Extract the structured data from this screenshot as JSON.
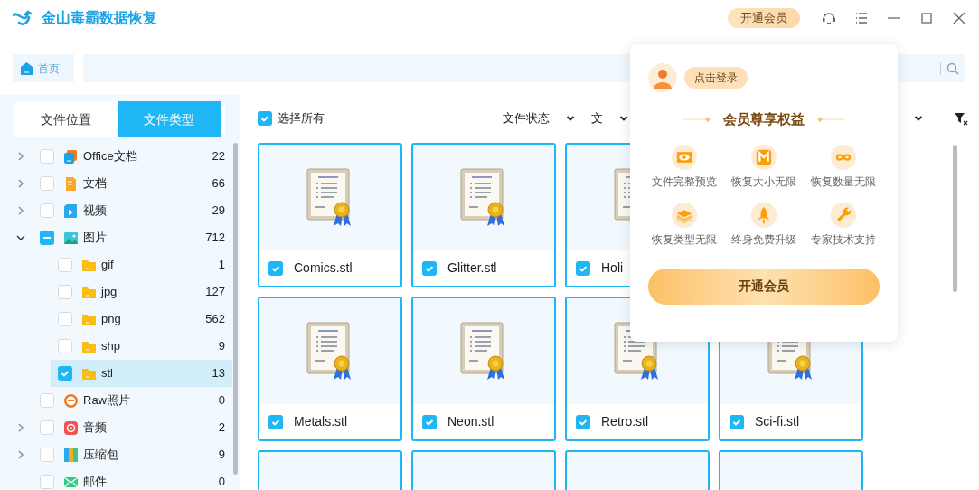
{
  "window": {
    "title": "金山毒霸数据恢复",
    "vip_button": "开通会员"
  },
  "nav": {
    "home_tab": "首页"
  },
  "sidebar": {
    "tabs": [
      {
        "label": "文件位置",
        "selected": false
      },
      {
        "label": "文件类型",
        "selected": true
      }
    ],
    "items": [
      {
        "kind": "office",
        "label": "Office文档",
        "count": "22",
        "checked": false,
        "partial": false,
        "expanded": false,
        "selected": false
      },
      {
        "kind": "doc",
        "label": "文档",
        "count": "66",
        "checked": false,
        "partial": false,
        "expanded": false,
        "selected": false
      },
      {
        "kind": "video",
        "label": "视频",
        "count": "29",
        "checked": false,
        "partial": false,
        "expanded": false,
        "selected": false
      },
      {
        "kind": "image",
        "label": "图片",
        "count": "712",
        "checked": false,
        "partial": true,
        "expanded": true,
        "selected": false,
        "children": [
          {
            "kind": "folder",
            "label": "gif",
            "count": "1",
            "checked": false,
            "partial": false,
            "selected": false
          },
          {
            "kind": "folder",
            "label": "jpg",
            "count": "127",
            "checked": false,
            "partial": false,
            "selected": false
          },
          {
            "kind": "folder",
            "label": "png",
            "count": "562",
            "checked": false,
            "partial": false,
            "selected": false
          },
          {
            "kind": "folder",
            "label": "shp",
            "count": "9",
            "checked": false,
            "partial": false,
            "selected": false
          },
          {
            "kind": "folder",
            "label": "stl",
            "count": "13",
            "checked": true,
            "partial": false,
            "selected": true
          }
        ]
      },
      {
        "kind": "raw",
        "label": "Raw照片",
        "count": "0",
        "checked": false,
        "partial": false,
        "selected": false
      },
      {
        "kind": "audio",
        "label": "音频",
        "count": "2",
        "checked": false,
        "partial": false,
        "expanded": false,
        "selected": false
      },
      {
        "kind": "archive",
        "label": "压缩包",
        "count": "9",
        "checked": false,
        "partial": false,
        "expanded": false,
        "selected": false
      },
      {
        "kind": "mail",
        "label": "邮件",
        "count": "0",
        "checked": false,
        "partial": false,
        "selected": false
      }
    ]
  },
  "toolbar": {
    "select_all": {
      "label": "选择所有",
      "checked": true
    },
    "filters": [
      {
        "label": "文件状态"
      },
      {
        "label": "文"
      }
    ]
  },
  "cards": [
    {
      "kind": "file",
      "name": "Comics.stl",
      "checked": true
    },
    {
      "kind": "file",
      "name": "Glitter.stl",
      "checked": true
    },
    {
      "kind": "file",
      "name": "Holi",
      "checked": true
    },
    {
      "kind": "hidden"
    },
    {
      "kind": "file",
      "name": "Metals.stl",
      "checked": true
    },
    {
      "kind": "file",
      "name": "Neon.stl",
      "checked": true
    },
    {
      "kind": "file",
      "name": "Retro.stl",
      "checked": true
    },
    {
      "kind": "file",
      "name": "Sci-fi.stl",
      "checked": true
    },
    {
      "kind": "partial"
    },
    {
      "kind": "partial"
    },
    {
      "kind": "partial"
    },
    {
      "kind": "partial"
    }
  ],
  "popup": {
    "login": "点击登录",
    "heading": "会员尊享权益",
    "benefits": [
      {
        "kind": "eye",
        "label": "文件完整预览"
      },
      {
        "kind": "m",
        "label": "恢复大小无限"
      },
      {
        "kind": "infinity",
        "label": "恢复数量无限"
      },
      {
        "kind": "layers",
        "label": "恢复类型无限"
      },
      {
        "kind": "rocket",
        "label": "终身免费升级"
      },
      {
        "kind": "wrench",
        "label": "专家技术支持"
      }
    ],
    "button": "开通会员"
  }
}
